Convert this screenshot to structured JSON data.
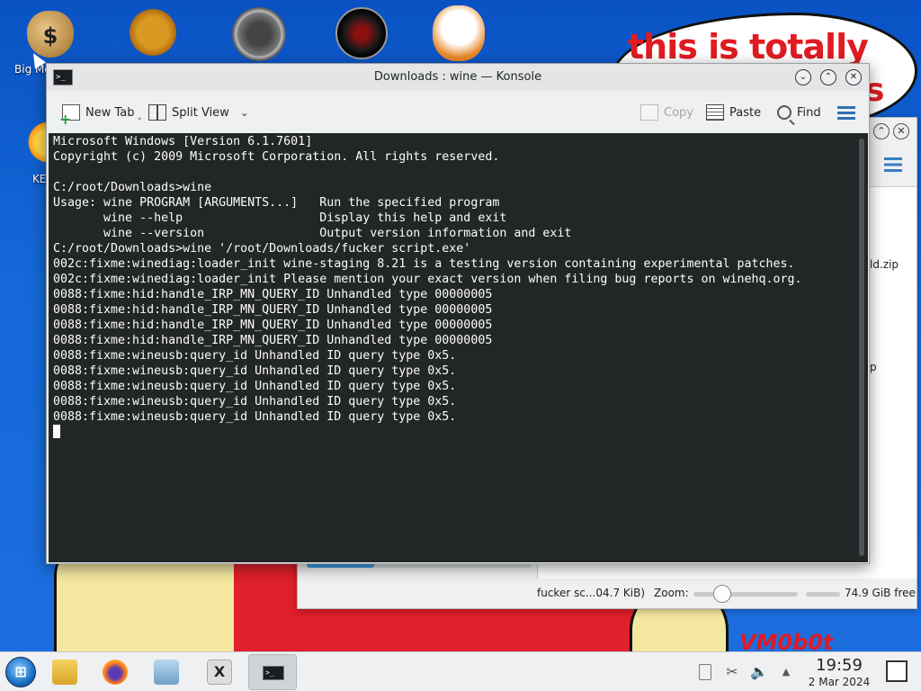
{
  "wallpaper": {
    "speech_line1": "this is totally",
    "speech_line2": "s",
    "corner_text": "VM0b0t"
  },
  "desktop_icons": [
    {
      "name": "moneybag-icon",
      "label": "Big Money Dev",
      "glyph": "$"
    },
    {
      "name": "gear-icon",
      "label": ""
    },
    {
      "name": "gauge-icon",
      "label": ""
    },
    {
      "name": "record-icon",
      "label": ""
    },
    {
      "name": "mascot-icon",
      "label": ""
    },
    {
      "name": "sun-icon",
      "label": "KEVIN"
    }
  ],
  "background_window": {
    "file1": "ld.zip",
    "file2": "p",
    "status_file": "fucker sc...04.7 KiB)",
    "zoom_label": "Zoom:",
    "free_space": "74.9 GiB free",
    "progress_fraction": 0.3,
    "back_glyph": "‹"
  },
  "konsole": {
    "title": "Downloads : wine — Konsole",
    "app_icon_text": ">_",
    "buttons": {
      "minimize": "⌄",
      "maximize": "⌃",
      "close": "✕"
    },
    "toolbar": {
      "new_tab": "New Tab",
      "split_view": "Split View",
      "copy": "Copy",
      "paste": "Paste",
      "find": "Find"
    },
    "terminal_lines": [
      "Microsoft Windows [Version 6.1.7601]",
      "Copyright (c) 2009 Microsoft Corporation. All rights reserved.",
      "",
      "C:/root/Downloads>wine",
      "Usage: wine PROGRAM [ARGUMENTS...]   Run the specified program",
      "       wine --help                   Display this help and exit",
      "       wine --version                Output version information and exit",
      "C:/root/Downloads>wine '/root/Downloads/fucker script.exe'",
      "002c:fixme:winediag:loader_init wine-staging 8.21 is a testing version containing experimental patches.",
      "002c:fixme:winediag:loader_init Please mention your exact version when filing bug reports on winehq.org.",
      "0088:fixme:hid:handle_IRP_MN_QUERY_ID Unhandled type 00000005",
      "0088:fixme:hid:handle_IRP_MN_QUERY_ID Unhandled type 00000005",
      "0088:fixme:hid:handle_IRP_MN_QUERY_ID Unhandled type 00000005",
      "0088:fixme:hid:handle_IRP_MN_QUERY_ID Unhandled type 00000005",
      "0088:fixme:wineusb:query_id Unhandled ID query type 0x5.",
      "0088:fixme:wineusb:query_id Unhandled ID query type 0x5.",
      "0088:fixme:wineusb:query_id Unhandled ID query type 0x5.",
      "0088:fixme:wineusb:query_id Unhandled ID query type 0x5.",
      "0088:fixme:wineusb:query_id Unhandled ID query type 0x5."
    ]
  },
  "taskbar": {
    "konsole_icon_text": ">_",
    "x_app_label": "X",
    "tray": {
      "scissors": "✂",
      "volume": "🔈",
      "expand": "▲"
    },
    "clock_time": "19:59",
    "clock_date": "2 Mar 2024"
  },
  "colors": {
    "terminal_bg": "#232627",
    "terminal_fg": "#fcfcfc",
    "accent": "#2f6fb2",
    "speech_red": "#e01b22"
  }
}
